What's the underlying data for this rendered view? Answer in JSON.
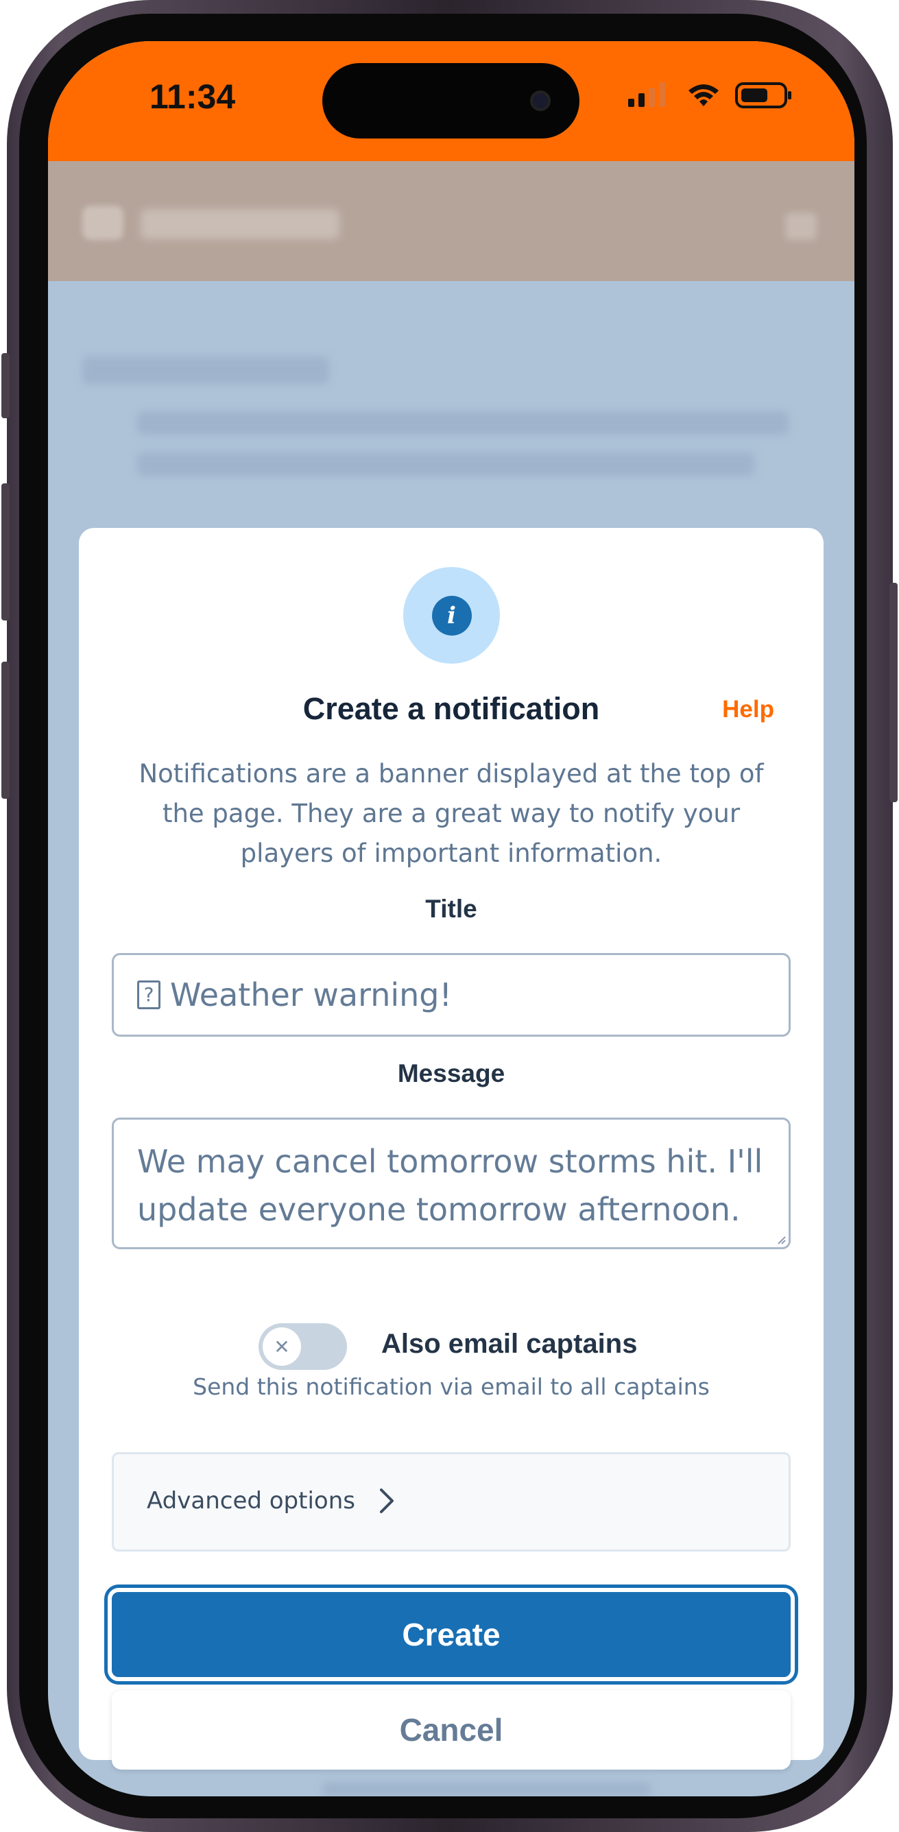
{
  "status_bar": {
    "time": "11:34",
    "background": "#ff6b00"
  },
  "dialog": {
    "icon": "info-icon",
    "title": "Create a notification",
    "help_label": "Help",
    "description": "Notifications are a banner displayed at the top of the page. They are a great way to notify your players of important information.",
    "title_field": {
      "label": "Title",
      "value": "Weather warning!",
      "glyph": "?"
    },
    "message_field": {
      "label": "Message",
      "value": "We may cancel tomorrow storms hit. I'll update everyone tomorrow afternoon."
    },
    "email_toggle": {
      "label": "Also email captains",
      "help": "Send this notification via email to all captains",
      "checked": false
    },
    "advanced_label": "Advanced options",
    "create_label": "Create",
    "cancel_label": "Cancel"
  },
  "colors": {
    "primary": "#186fb4",
    "accent": "#ff6b00",
    "text_dark": "#17263a",
    "text_muted": "#5d7692"
  }
}
